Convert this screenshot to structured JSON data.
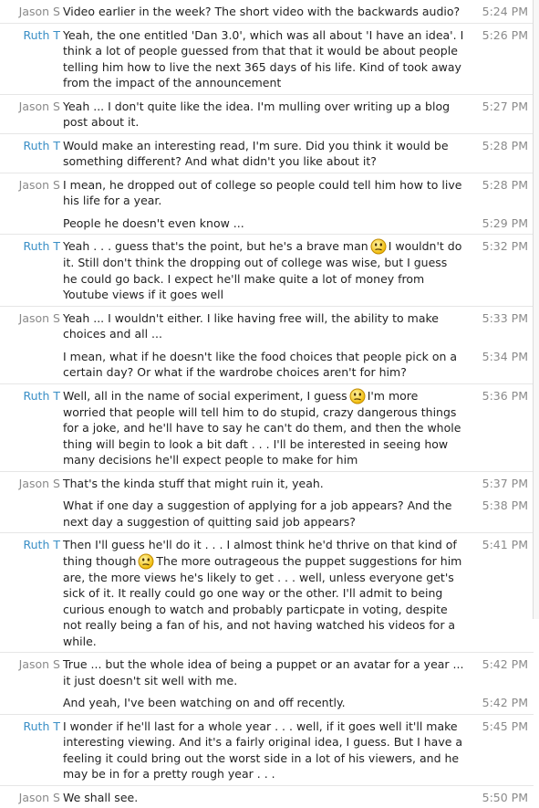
{
  "messages": [
    {
      "sender": "Jason S",
      "text": "Video earlier in the week? The short video with the backwards audio?",
      "time": "5:24 PM"
    },
    {
      "sender": "Ruth T",
      "text": "Yeah, the one entitled 'Dan 3.0', which was all about 'I have an idea'.  I think a lot of people guessed from that that it would be about people telling him how to live the next 365 days of his life.  Kind of took away from the impact of the announcement",
      "time": "5:26 PM"
    },
    {
      "sender": "Jason S",
      "text": "Yeah ... I don't quite like the idea. I'm mulling over writing up a blog post about it.",
      "time": "5:27 PM"
    },
    {
      "sender": "Ruth T",
      "text": "Would make an interesting read, I'm sure.  Did you think it would be something different?  And what didn't you like about it?",
      "time": "5:28 PM"
    },
    {
      "sender": "Jason S",
      "text": "I mean, he dropped out of college so people could tell him how to live his life for a year.",
      "time": "5:28 PM"
    },
    {
      "sender": "",
      "text": "People he doesn't even know ...",
      "time": "5:29 PM"
    },
    {
      "sender": "Ruth T",
      "parts": [
        "Yeah . . . guess that's the point, but he's a brave man",
        "I wouldn't do it.  Still don't think the dropping out of college was wise, but I guess he could go back.  I expect he'll make quite a lot of money from Youtube views if it goes well"
      ],
      "time": "5:32 PM"
    },
    {
      "sender": "Jason S",
      "text": "Yeah ... I wouldn't either. I like having free will, the ability to make choices and all ...",
      "time": "5:33 PM"
    },
    {
      "sender": "",
      "text": "I mean, what if he doesn't like the food choices that people pick on a certain day? Or what if the wardrobe choices aren't for him?",
      "time": "5:34 PM"
    },
    {
      "sender": "Ruth T",
      "parts": [
        "Well, all in the name of social experiment, I guess",
        "I'm more worried that people will tell him to do stupid, crazy dangerous things for a joke, and he'll have to say he can't do them, and then the whole thing will begin to look a bit daft . . . I'll be interested in seeing how many decisions he'll expect people to make for him"
      ],
      "time": "5:36 PM"
    },
    {
      "sender": "Jason S",
      "text": "That's the kinda stuff that might ruin it, yeah.",
      "time": "5:37 PM"
    },
    {
      "sender": "",
      "text": "What if one day a suggestion of applying for a job appears? And the next day a suggestion of quitting said job appears?",
      "time": "5:38 PM"
    },
    {
      "sender": "Ruth T",
      "parts": [
        "Then I'll guess he'll do it . . . I almost think he'd thrive on that kind of thing though",
        "The more outrageous the puppet suggestions for him are, the more views he's likely to get . . . well, unless everyone get's sick of it.  It really could go one way or the other.  I'll admit to being curious enough to watch and probably particpate in voting, despite not really being a fan of his, and not having watched his videos for a while."
      ],
      "time": "5:41 PM"
    },
    {
      "sender": "Jason S",
      "text": "True ... but the whole idea of being a puppet or an avatar for a year ... it just doesn't sit well with me.",
      "time": "5:42 PM"
    },
    {
      "sender": "",
      "text": "And yeah, I've been watching on and off recently.",
      "time": "5:42 PM"
    },
    {
      "sender": "Ruth T",
      "text": "I wonder if he'll last for a whole year . . . well, if it goes well it'll make interesting viewing.  And it's a fairly original idea, I guess.  But I have a feeling it could bring out the worst side in a lot of his viewers, and he may be in for a pretty rough year . . .",
      "time": "5:45 PM"
    },
    {
      "sender": "Jason S",
      "text": "We shall see.",
      "time": "5:50 PM"
    }
  ],
  "colors": {
    "ruth": "#3a8fc6",
    "jason": "#8a8a8a",
    "timestamp": "#8a8a8a",
    "emoticon": "#f5c518"
  },
  "icons": {
    "emoticon": "confused-smiley-icon"
  }
}
